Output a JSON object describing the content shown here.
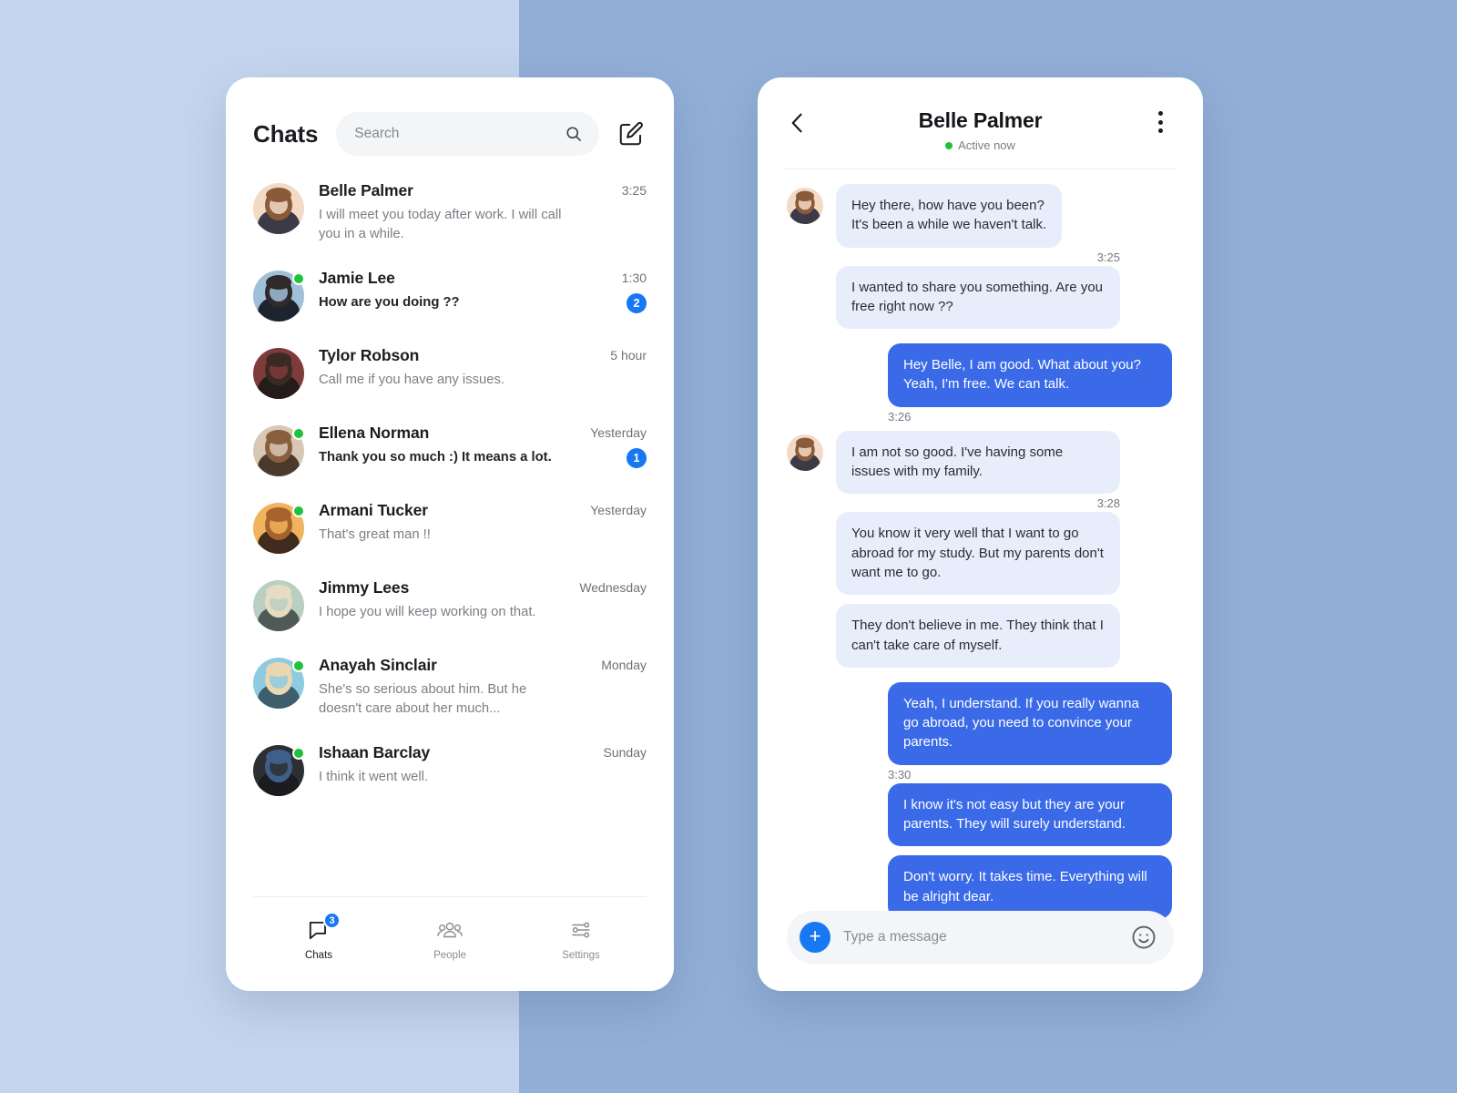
{
  "background": {
    "left_color": "#c5d5ee",
    "right_color": "#92afd7"
  },
  "theme": {
    "accent": "#1877f2",
    "bubble_out": "#3b6ae8",
    "bubble_in": "#e8edfb",
    "online": "#1ec23c"
  },
  "chat_list": {
    "title": "Chats",
    "search": {
      "value": "",
      "placeholder": "Search"
    },
    "compose_icon": "compose-pencil-icon",
    "search_icon": "search-icon",
    "items": [
      {
        "name": "Belle Palmer",
        "preview": "I will meet you today after work. I will call you in a while.",
        "time": "3:25",
        "unread": "",
        "online": false,
        "bold": false,
        "avatar": "belle"
      },
      {
        "name": "Jamie Lee",
        "preview": "How are you doing ??",
        "time": "1:30",
        "unread": "2",
        "online": true,
        "bold": true,
        "avatar": "jamie"
      },
      {
        "name": "Tylor Robson",
        "preview": "Call me if you have any issues.",
        "time": "5 hour",
        "unread": "",
        "online": false,
        "bold": false,
        "avatar": "tylor"
      },
      {
        "name": "Ellena Norman",
        "preview": "Thank you so much :) It means a lot.",
        "time": "Yesterday",
        "unread": "1",
        "online": true,
        "bold": true,
        "avatar": "ellena"
      },
      {
        "name": "Armani Tucker",
        "preview": "That's great man !!",
        "time": "Yesterday",
        "unread": "",
        "online": true,
        "bold": false,
        "avatar": "armani"
      },
      {
        "name": "Jimmy Lees",
        "preview": "I hope you will keep working on that.",
        "time": "Wednesday",
        "unread": "",
        "online": false,
        "bold": false,
        "avatar": "jimmy"
      },
      {
        "name": "Anayah Sinclair",
        "preview": "She's so serious about him. But he doesn't care about her much...",
        "time": "Monday",
        "unread": "",
        "online": true,
        "bold": false,
        "avatar": "anayah"
      },
      {
        "name": "Ishaan Barclay",
        "preview": "I think it went well.",
        "time": "Sunday",
        "unread": "",
        "online": true,
        "bold": false,
        "avatar": "ishaan"
      }
    ],
    "tabs": [
      {
        "label": "Chats",
        "icon": "chat-bubble-icon",
        "badge": "3",
        "active": true
      },
      {
        "label": "People",
        "icon": "people-group-icon",
        "badge": "",
        "active": false
      },
      {
        "label": "Settings",
        "icon": "sliders-icon",
        "badge": "",
        "active": false
      }
    ]
  },
  "conversation": {
    "back_icon": "chevron-left-icon",
    "more_icon": "more-vertical-icon",
    "name": "Belle Palmer",
    "status": "Active now",
    "groups": [
      {
        "side": "in",
        "avatar": "belle",
        "show_avatar": true,
        "bubbles": [
          "Hey there, how have you been?\nIt's been a while we haven't talk.",
          "I wanted to share you something. Are you free right now ??"
        ],
        "timestamp": "3:25",
        "ts_after": 0
      },
      {
        "side": "out",
        "avatar": "",
        "show_avatar": false,
        "bubbles": [
          "Hey Belle, I am good. What about you? Yeah, I'm free. We can talk."
        ],
        "timestamp": "3:26",
        "ts_after": 0
      },
      {
        "side": "in",
        "avatar": "belle",
        "show_avatar": true,
        "bubbles": [
          "I am not so good. I've having some issues with my family.",
          "You know it very well that I want to go abroad for my study. But my parents don't want me to go.",
          "They don't believe in me. They think that I can't take care of myself."
        ],
        "timestamp": "3:28",
        "ts_after": 0
      },
      {
        "side": "out",
        "avatar": "",
        "show_avatar": false,
        "bubbles": [
          "Yeah, I understand. If you really wanna go abroad, you need to convince your parents.",
          "I know it's not easy but they are your parents. They will surely understand.",
          "Don't worry. It takes time. Everything will be alright dear."
        ],
        "timestamp": "3:30",
        "ts_after": 0
      }
    ],
    "composer": {
      "plus_icon": "plus-icon",
      "value": "",
      "placeholder": "Type a message",
      "emoji_icon": "smiley-icon"
    }
  }
}
